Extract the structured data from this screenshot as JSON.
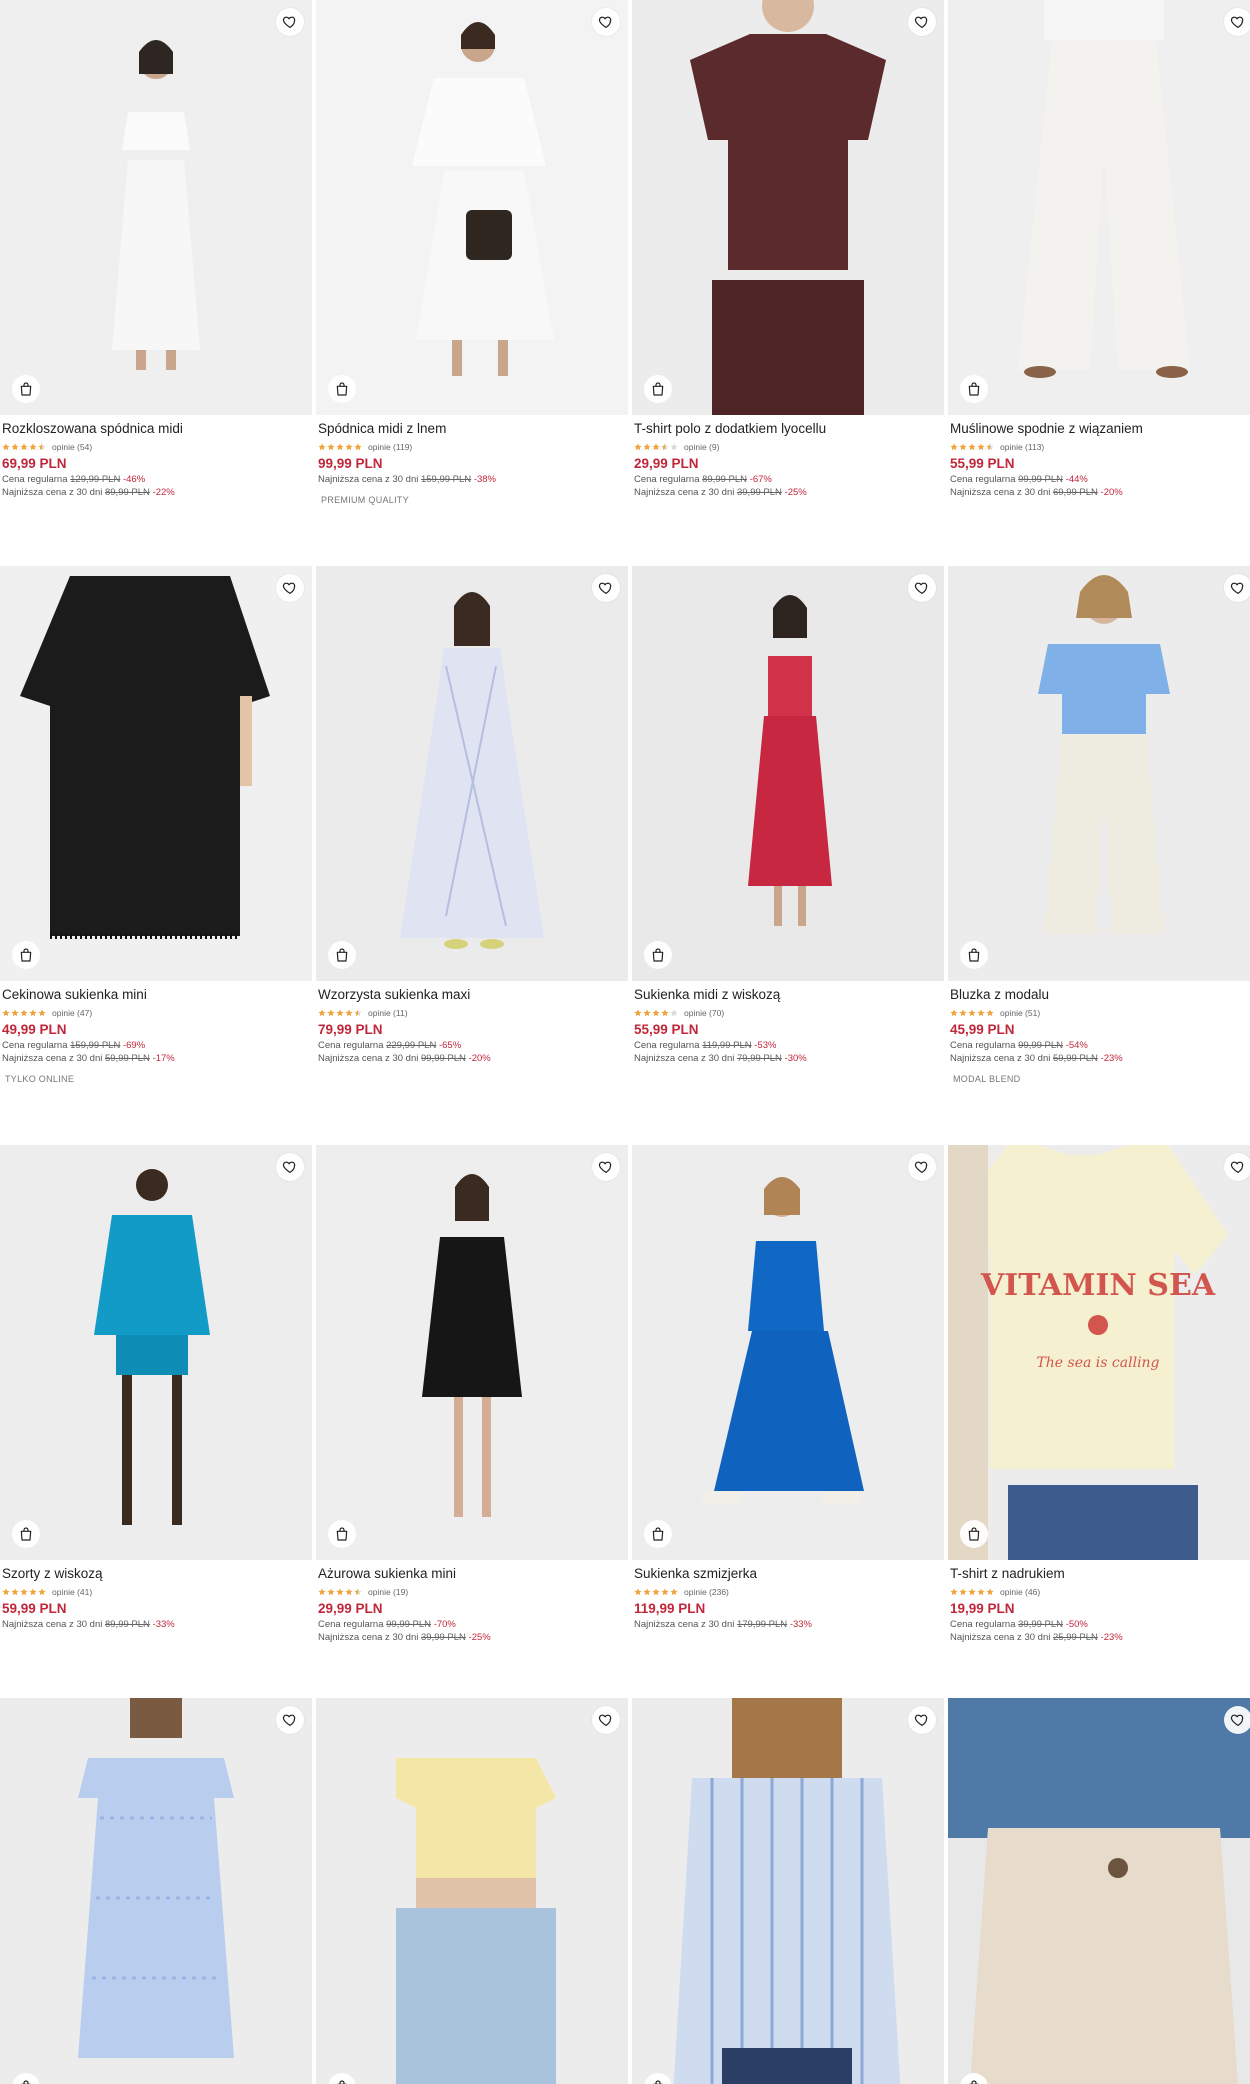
{
  "products": [
    {
      "name": "Rozkloszowana spódnica midi",
      "rating": 4.5,
      "reviews": "opinie (54)",
      "price": "69,99 PLN",
      "regular": {
        "label": "Cena regularna",
        "old": "129,99 PLN",
        "disc": "-46%"
      },
      "lowest": {
        "label": "Najniższa cena z 30 dni",
        "old": "89,99 PLN",
        "disc": "-22%"
      },
      "tag": ""
    },
    {
      "name": "Spódnica midi z lnem",
      "rating": 5,
      "reviews": "opinie (119)",
      "price": "99,99 PLN",
      "regular": null,
      "lowest": {
        "label": "Najniższa cena z 30 dni",
        "old": "159,99 PLN",
        "disc": "-38%"
      },
      "tag": "PREMIUM QUALITY"
    },
    {
      "name": "T-shirt polo z dodatkiem lyocellu",
      "rating": 3.5,
      "reviews": "opinie (9)",
      "price": "29,99 PLN",
      "regular": {
        "label": "Cena regularna",
        "old": "89,99 PLN",
        "disc": "-67%"
      },
      "lowest": {
        "label": "Najniższa cena z 30 dni",
        "old": "39,99 PLN",
        "disc": "-25%"
      },
      "tag": ""
    },
    {
      "name": "Muślinowe spodnie z wiązaniem",
      "rating": 4.5,
      "reviews": "opinie (113)",
      "price": "55,99 PLN",
      "regular": {
        "label": "Cena regularna",
        "old": "99,99 PLN",
        "disc": "-44%"
      },
      "lowest": {
        "label": "Najniższa cena z 30 dni",
        "old": "69,99 PLN",
        "disc": "-20%"
      },
      "tag": ""
    },
    {
      "name": "Cekinowa sukienka mini",
      "rating": 5,
      "reviews": "opinie (47)",
      "price": "49,99 PLN",
      "regular": {
        "label": "Cena regularna",
        "old": "159,99 PLN",
        "disc": "-69%"
      },
      "lowest": {
        "label": "Najniższa cena z 30 dni",
        "old": "59,99 PLN",
        "disc": "-17%"
      },
      "tag": "TYLKO ONLINE"
    },
    {
      "name": "Wzorzysta sukienka maxi",
      "rating": 4.5,
      "reviews": "opinie (11)",
      "price": "79,99 PLN",
      "regular": {
        "label": "Cena regularna",
        "old": "229,99 PLN",
        "disc": "-65%"
      },
      "lowest": {
        "label": "Najniższa cena z 30 dni",
        "old": "99,99 PLN",
        "disc": "-20%"
      },
      "tag": ""
    },
    {
      "name": "Sukienka midi z wiskozą",
      "rating": 4,
      "reviews": "opinie (70)",
      "price": "55,99 PLN",
      "regular": {
        "label": "Cena regularna",
        "old": "119,99 PLN",
        "disc": "-53%"
      },
      "lowest": {
        "label": "Najniższa cena z 30 dni",
        "old": "79,99 PLN",
        "disc": "-30%"
      },
      "tag": ""
    },
    {
      "name": "Bluzka z modalu",
      "rating": 5,
      "reviews": "opinie (51)",
      "price": "45,99 PLN",
      "regular": {
        "label": "Cena regularna",
        "old": "99,99 PLN",
        "disc": "-54%"
      },
      "lowest": {
        "label": "Najniższa cena z 30 dni",
        "old": "59,99 PLN",
        "disc": "-23%"
      },
      "tag": "MODAL BLEND"
    },
    {
      "name": "Szorty z wiskozą",
      "rating": 5,
      "reviews": "opinie (41)",
      "price": "59,99 PLN",
      "regular": null,
      "lowest": {
        "label": "Najniższa cena z 30 dni",
        "old": "89,99 PLN",
        "disc": "-33%"
      },
      "tag": ""
    },
    {
      "name": "Ażurowa sukienka mini",
      "rating": 4.5,
      "reviews": "opinie (19)",
      "price": "29,99 PLN",
      "regular": {
        "label": "Cena regularna",
        "old": "99,99 PLN",
        "disc": "-70%"
      },
      "lowest": {
        "label": "Najniższa cena z 30 dni",
        "old": "39,99 PLN",
        "disc": "-25%"
      },
      "tag": ""
    },
    {
      "name": "Sukienka szmizjerka",
      "rating": 5,
      "reviews": "opinie (236)",
      "price": "119,99 PLN",
      "regular": null,
      "lowest": {
        "label": "Najniższa cena z 30 dni",
        "old": "179,99 PLN",
        "disc": "-33%"
      },
      "tag": ""
    },
    {
      "name": "T-shirt z nadrukiem",
      "rating": 5,
      "reviews": "opinie (46)",
      "price": "19,99 PLN",
      "regular": {
        "label": "Cena regularna",
        "old": "39,99 PLN",
        "disc": "-50%"
      },
      "lowest": {
        "label": "Najniższa cena z 30 dni",
        "old": "25,99 PLN",
        "disc": "-23%"
      },
      "tag": ""
    },
    {
      "name": "",
      "rating": 0,
      "reviews": "",
      "price": "",
      "regular": null,
      "lowest": null,
      "tag": ""
    },
    {
      "name": "",
      "rating": 0,
      "reviews": "",
      "price": "",
      "regular": null,
      "lowest": null,
      "tag": ""
    },
    {
      "name": "",
      "rating": 0,
      "reviews": "",
      "price": "",
      "regular": null,
      "lowest": null,
      "tag": ""
    },
    {
      "name": "",
      "rating": 0,
      "reviews": "",
      "price": "",
      "regular": null,
      "lowest": null,
      "tag": ""
    }
  ],
  "print_text": {
    "title": "VITAMIN SEA",
    "subtitle": "The sea is calling"
  },
  "colors": {
    "price": "#c0273a",
    "star": "#f0a23b",
    "star_empty": "#d9d9d9",
    "photo_bg": "#ededed"
  },
  "icons": {
    "favorite": "heart-icon",
    "cart": "shopping-bag-icon",
    "rating": "star-icon"
  }
}
